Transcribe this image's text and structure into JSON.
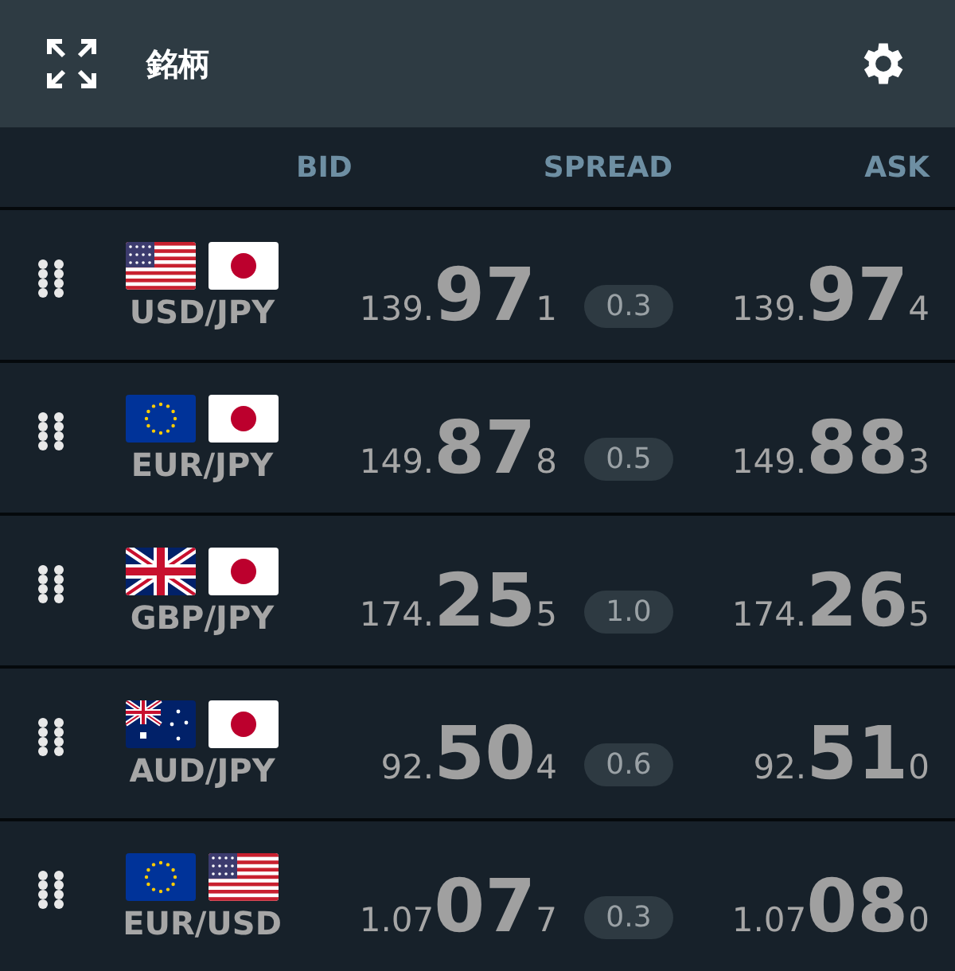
{
  "header": {
    "title": "銘柄"
  },
  "columns": [
    "BID",
    "SPREAD",
    "ASK"
  ],
  "rows": [
    {
      "pair": "USD/JPY",
      "flags": [
        {
          "kind": "us"
        },
        {
          "kind": "jp"
        }
      ],
      "bid": {
        "lead": "139.",
        "big": "97",
        "pip": "1"
      },
      "spread": "0.3",
      "ask": {
        "lead": "139.",
        "big": "97",
        "pip": "4"
      }
    },
    {
      "pair": "EUR/JPY",
      "flags": [
        {
          "kind": "eu"
        },
        {
          "kind": "jp"
        }
      ],
      "bid": {
        "lead": "149.",
        "big": "87",
        "pip": "8"
      },
      "spread": "0.5",
      "ask": {
        "lead": "149.",
        "big": "88",
        "pip": "3"
      }
    },
    {
      "pair": "GBP/JPY",
      "flags": [
        {
          "kind": "gb"
        },
        {
          "kind": "jp"
        }
      ],
      "bid": {
        "lead": "174.",
        "big": "25",
        "pip": "5"
      },
      "spread": "1.0",
      "ask": {
        "lead": "174.",
        "big": "26",
        "pip": "5"
      }
    },
    {
      "pair": "AUD/JPY",
      "flags": [
        {
          "kind": "au"
        },
        {
          "kind": "jp"
        }
      ],
      "bid": {
        "lead": "92.",
        "big": "50",
        "pip": "4"
      },
      "spread": "0.6",
      "ask": {
        "lead": "92.",
        "big": "51",
        "pip": "0"
      }
    },
    {
      "pair": "EUR/USD",
      "flags": [
        {
          "kind": "eu"
        },
        {
          "kind": "us"
        }
      ],
      "bid": {
        "lead": "1.07",
        "big": "07",
        "pip": "7"
      },
      "spread": "0.3",
      "ask": {
        "lead": "1.07",
        "big": "08",
        "pip": "0"
      }
    }
  ]
}
